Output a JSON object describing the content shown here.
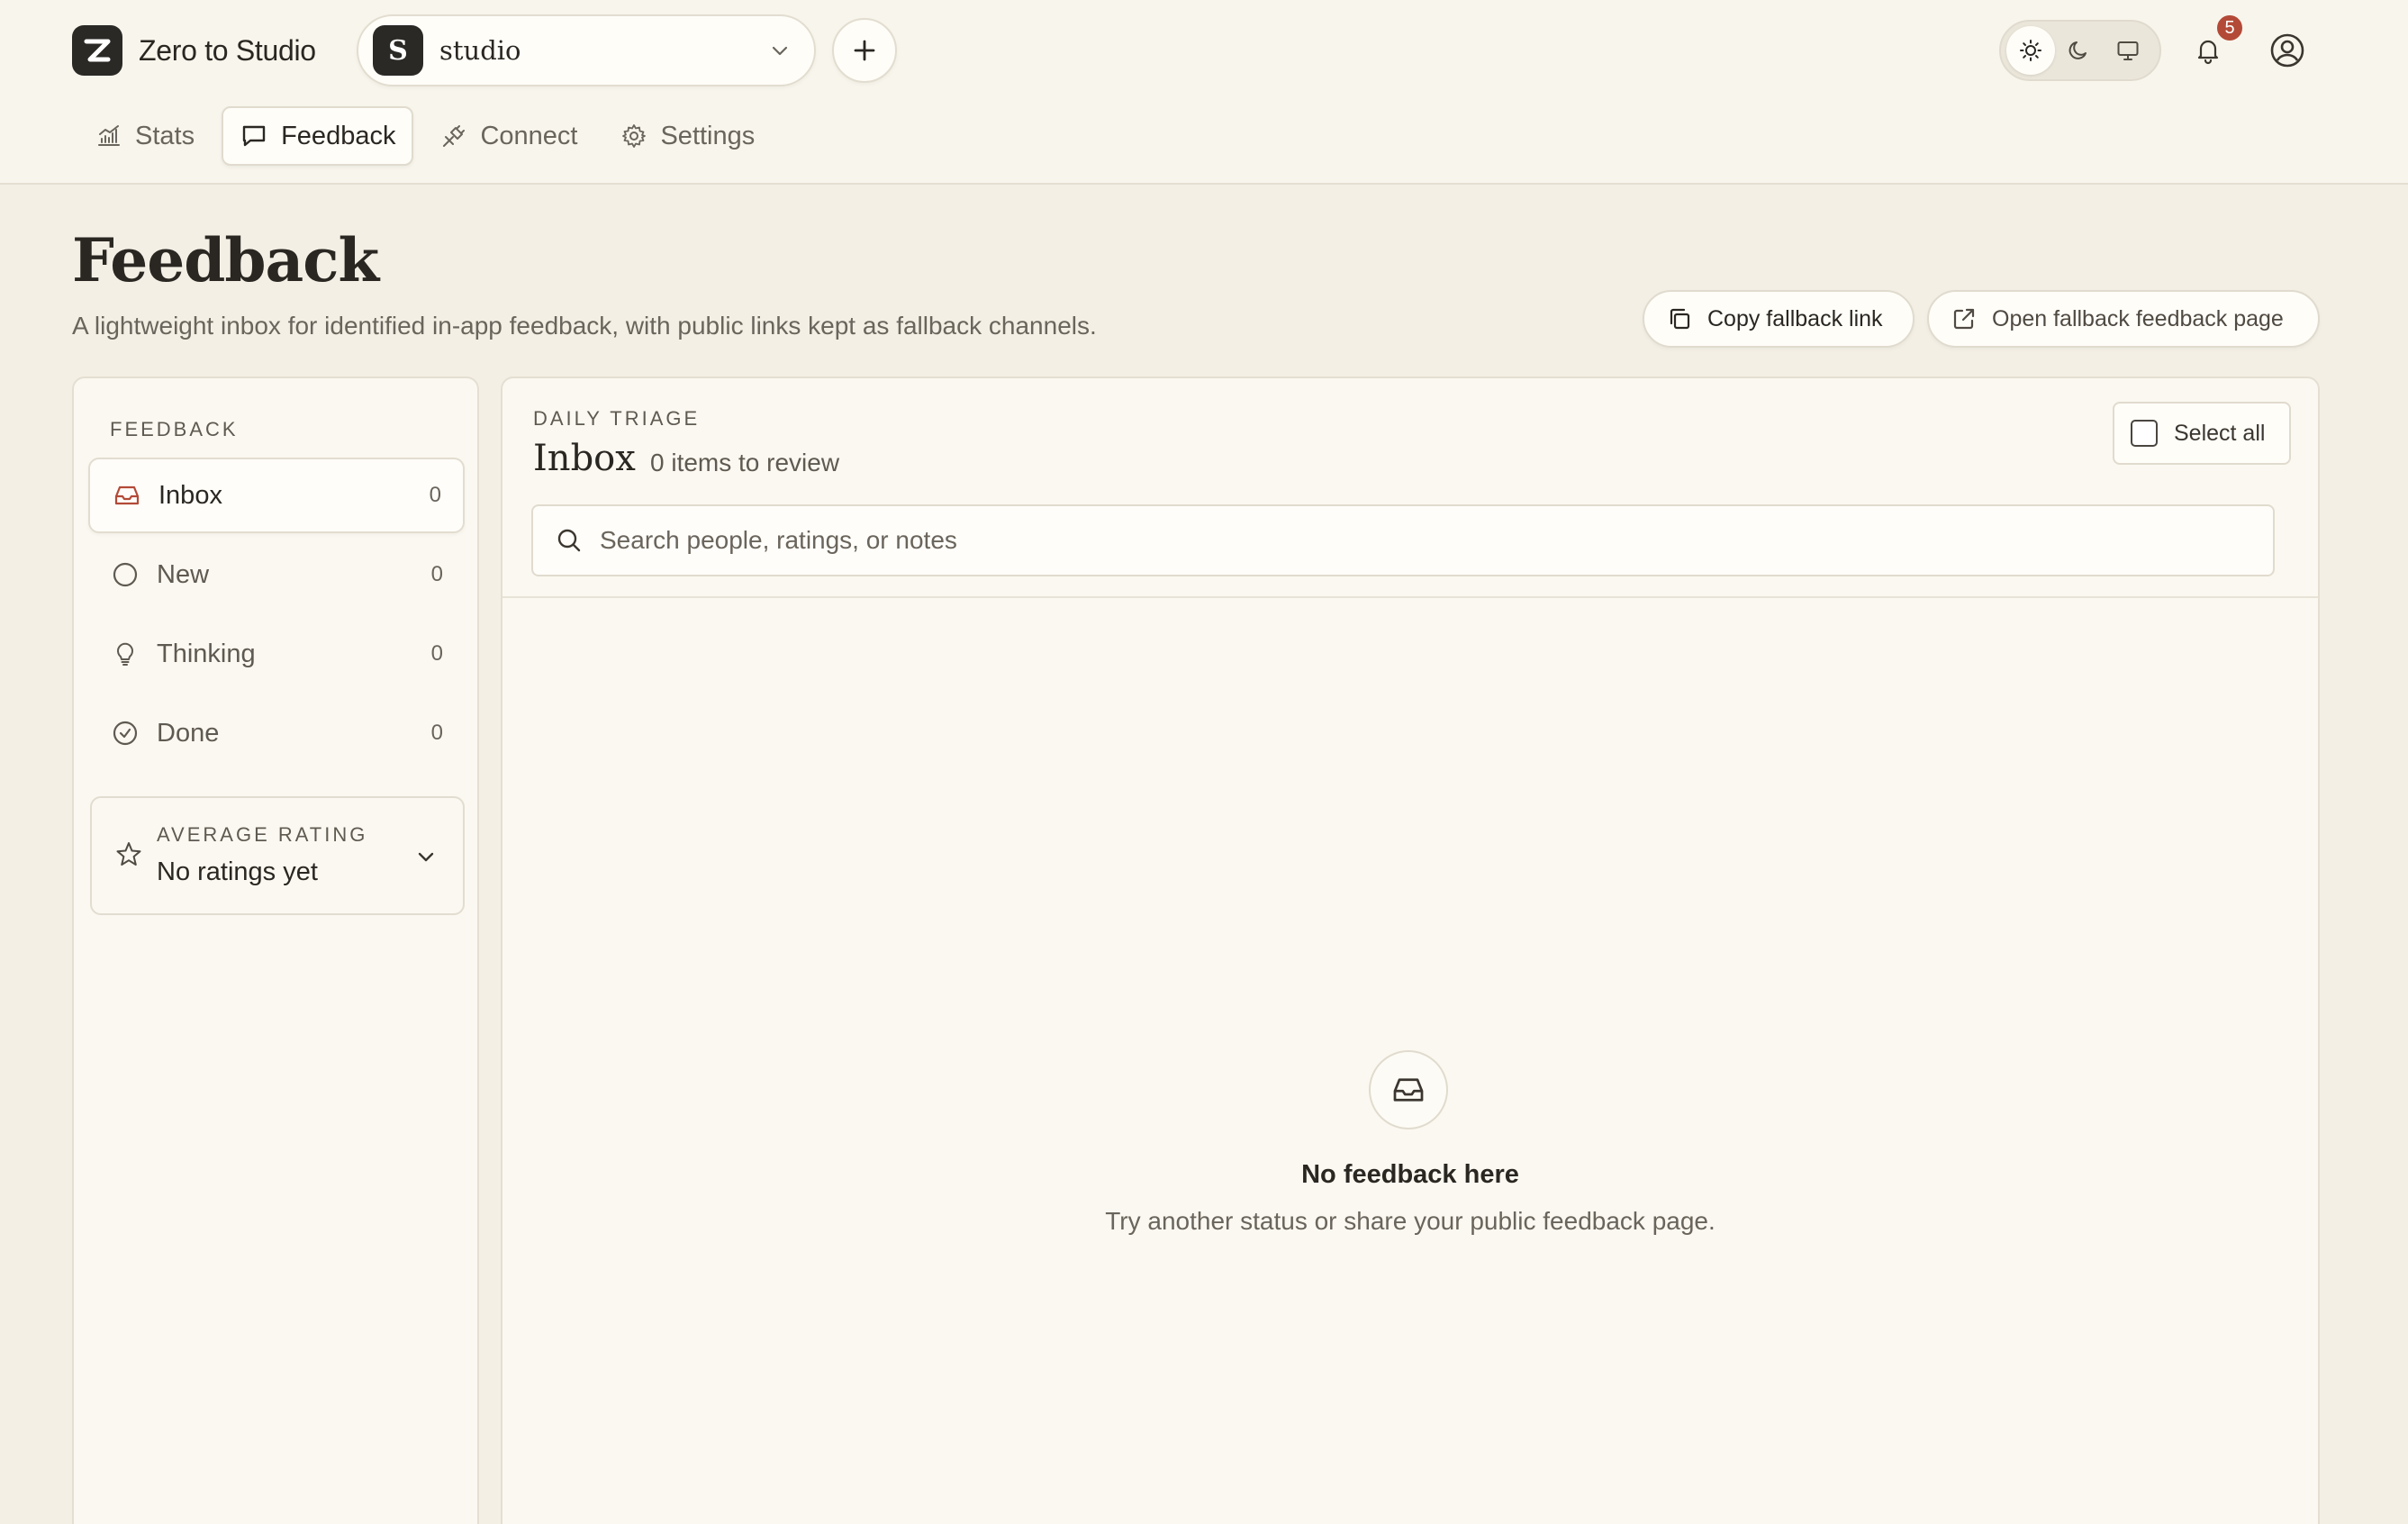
{
  "brand": {
    "name": "Zero to Studio",
    "logo_letter": "Z"
  },
  "project": {
    "initial": "S",
    "name": "studio"
  },
  "notifications": {
    "count": "5"
  },
  "tabs": [
    {
      "label": "Stats",
      "icon": "chart-icon"
    },
    {
      "label": "Feedback",
      "icon": "message-icon",
      "active": true
    },
    {
      "label": "Connect",
      "icon": "plug-icon"
    },
    {
      "label": "Settings",
      "icon": "gear-icon"
    }
  ],
  "page": {
    "title": "Feedback",
    "subtitle": "A lightweight inbox for identified in-app feedback, with public links kept as fallback channels.",
    "copy_link_label": "Copy fallback link",
    "open_page_label": "Open fallback feedback page"
  },
  "sidebar": {
    "heading": "FEEDBACK",
    "items": [
      {
        "label": "Inbox",
        "count": "0",
        "icon": "inbox-icon",
        "active": true
      },
      {
        "label": "New",
        "count": "0",
        "icon": "circle-icon"
      },
      {
        "label": "Thinking",
        "count": "0",
        "icon": "lightbulb-icon"
      },
      {
        "label": "Done",
        "count": "0",
        "icon": "check-circle-icon"
      }
    ],
    "rating": {
      "label": "AVERAGE RATING",
      "value": "No ratings yet"
    }
  },
  "main": {
    "eyebrow": "DAILY TRIAGE",
    "title": "Inbox",
    "count_text": "0 items to review",
    "select_all_label": "Select all",
    "search_placeholder": "Search people, ratings, or notes",
    "empty_title": "No feedback here",
    "empty_desc": "Try another status or share your public feedback page."
  },
  "colors": {
    "background": "#f3efe5",
    "header": "#f8f5ec",
    "accent_dark": "#2b2926",
    "badge": "#b34a37",
    "inbox_icon": "#b34a37"
  }
}
